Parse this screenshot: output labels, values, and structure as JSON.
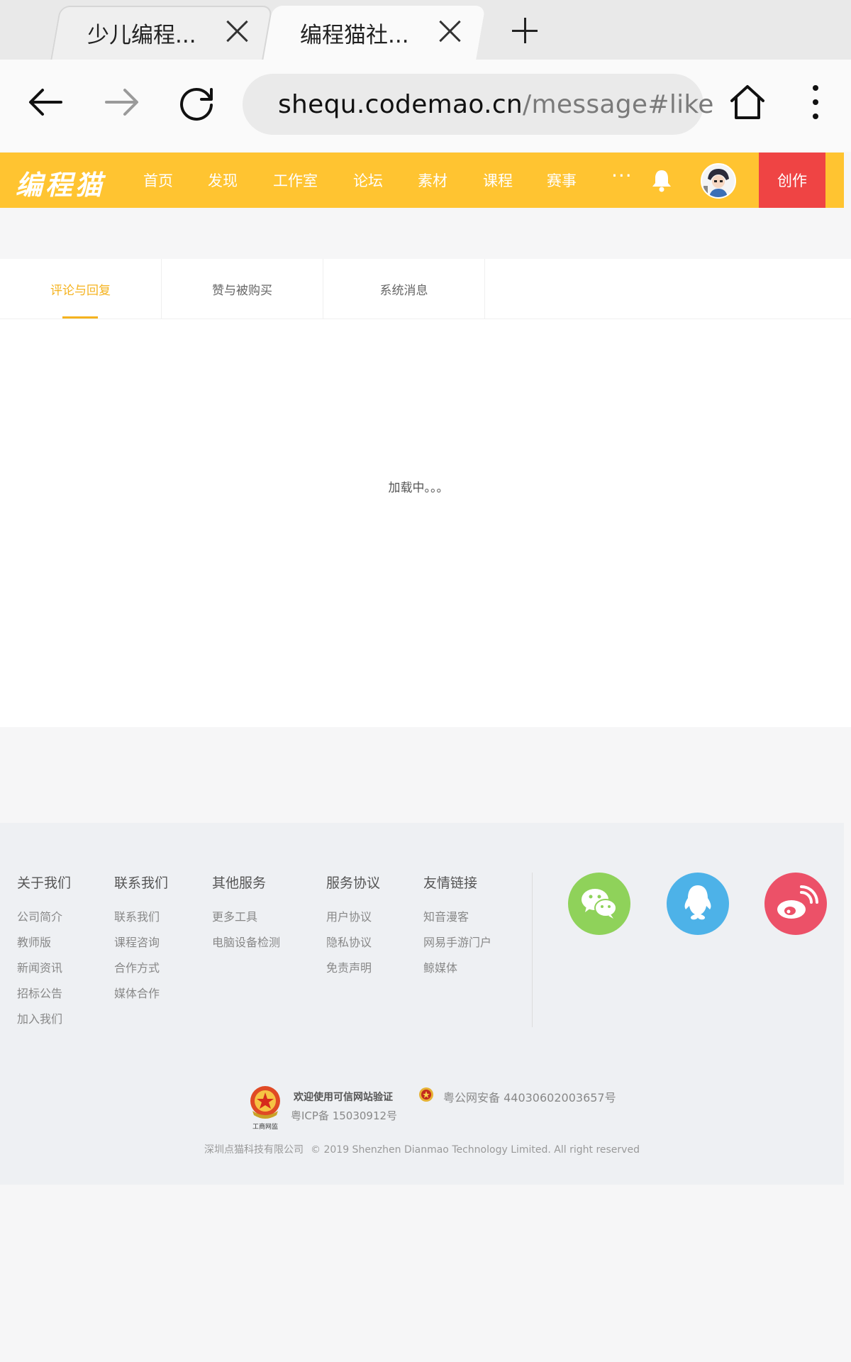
{
  "browser": {
    "tabs": [
      {
        "title": "少儿编程..."
      },
      {
        "title": "编程猫社..."
      }
    ],
    "url_host": "shequ.codemao.cn",
    "url_path": "/message#like"
  },
  "site": {
    "logo": "编程猫",
    "nav": [
      "首页",
      "发现",
      "工作室",
      "论坛",
      "素材",
      "课程",
      "赛事"
    ],
    "more": "···",
    "create_label": "创作",
    "accent_color": "#ffc431",
    "create_color": "#ef4444"
  },
  "messages": {
    "tabs": [
      "评论与回复",
      "赞与被购买",
      "系统消息"
    ],
    "active_tab": 0,
    "loading_text": "加载中。。。"
  },
  "footer": {
    "columns": [
      {
        "title": "关于我们",
        "links": [
          "公司简介",
          "教师版",
          "新闻资讯",
          "招标公告",
          "加入我们"
        ]
      },
      {
        "title": "联系我们",
        "links": [
          "联系我们",
          "课程咨询",
          "合作方式",
          "媒体合作"
        ]
      },
      {
        "title": "其他服务",
        "links": [
          "更多工具",
          "电脑设备检测"
        ]
      },
      {
        "title": "服务协议",
        "links": [
          "用户协议",
          "隐私协议",
          "免责声明"
        ]
      },
      {
        "title": "友情链接",
        "links": [
          "知音漫客",
          "网易手游门户",
          "鲸媒体"
        ]
      }
    ],
    "social": [
      "wechat-icon",
      "qq-icon",
      "weibo-icon"
    ],
    "cert_welcome": "欢迎使用可信网站验证",
    "icp": "粤ICP备 15030912号",
    "gongan": "粤公网安备 44030602003657号",
    "emblem_caption": "工商网监",
    "company": "深圳点猫科技有限公司",
    "copyright": "© 2019 Shenzhen Dianmao Technology Limited. All right reserved"
  }
}
